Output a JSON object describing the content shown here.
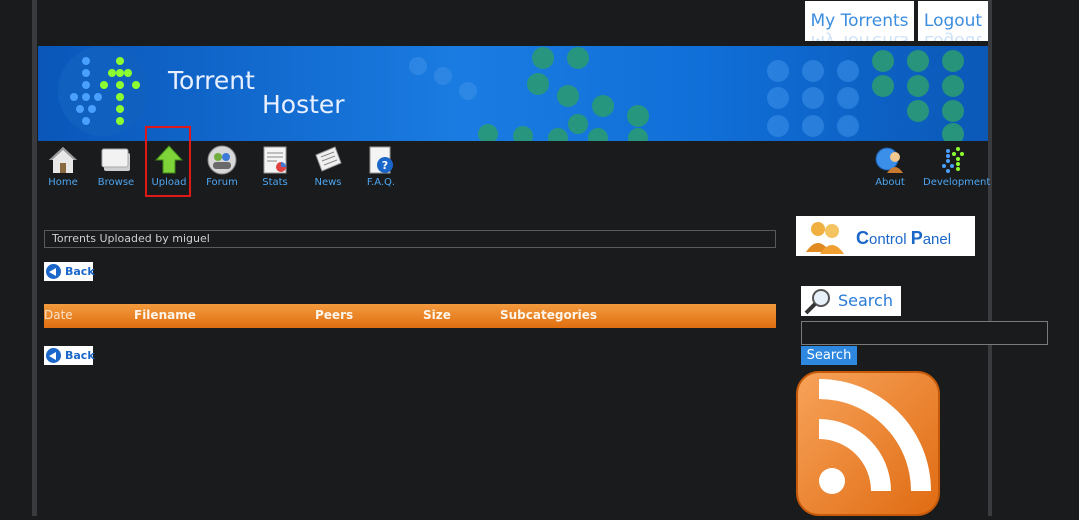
{
  "header": {
    "my_torrents": "My Torrents",
    "logout": "Logout",
    "site_title_line1": "Torrent",
    "site_title_line2": "Hoster"
  },
  "nav": {
    "home": "Home",
    "browse": "Browse",
    "upload": "Upload",
    "forum": "Forum",
    "stats": "Stats",
    "news": "News",
    "faq": "F.A.Q.",
    "about": "About",
    "development": "Development"
  },
  "main": {
    "page_title": "Torrents Uploaded by miguel",
    "back_label": "Back",
    "columns": [
      "Date",
      "Filename",
      "Peers",
      "Size",
      "Subcategories"
    ],
    "rows": []
  },
  "sidebar": {
    "control_panel_initial1": "C",
    "control_panel_rest1": "ontrol ",
    "control_panel_initial2": "P",
    "control_panel_rest2": "anel",
    "search_heading": "Search",
    "search_value": "",
    "search_button": "Search"
  },
  "colors": {
    "background": "#1a1b1d",
    "link_blue": "#4ea5f0",
    "table_header_orange": "#e87f22",
    "highlight_red": "#e01818"
  }
}
